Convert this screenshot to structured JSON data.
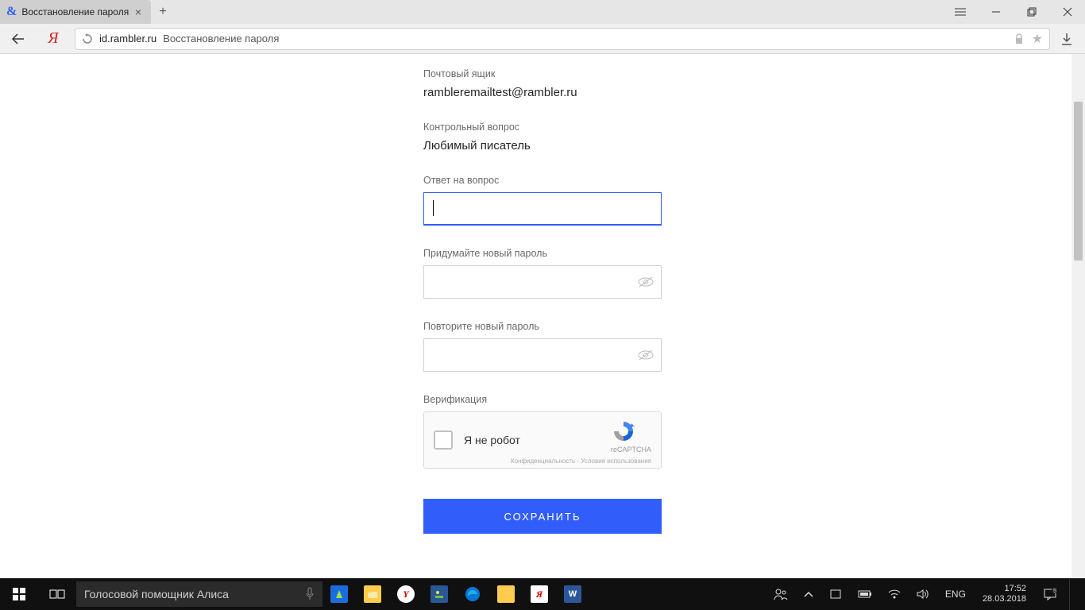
{
  "browser": {
    "tab_title": "Восстановление пароля",
    "url_host": "id.rambler.ru",
    "url_title": "Восстановление пароля"
  },
  "form": {
    "mailbox_label": "Почтовый ящик",
    "mailbox_value": "rambleremailtest@rambler.ru",
    "question_label": "Контрольный вопрос",
    "question_value": "Любимый писатель",
    "answer_label": "Ответ на вопрос",
    "newpass_label": "Придумайте новый пароль",
    "repeatpass_label": "Повторите новый пароль",
    "verification_label": "Верификация",
    "captcha_label": "Я не робот",
    "captcha_brand": "reCAPTCHA",
    "captcha_legal": "Конфиденциальность - Условия использования",
    "save_button": "СОХРАНИТЬ"
  },
  "taskbar": {
    "search_text": "Голосовой помощник Алиса",
    "lang": "ENG",
    "time": "17:52",
    "date": "28.03.2018"
  }
}
